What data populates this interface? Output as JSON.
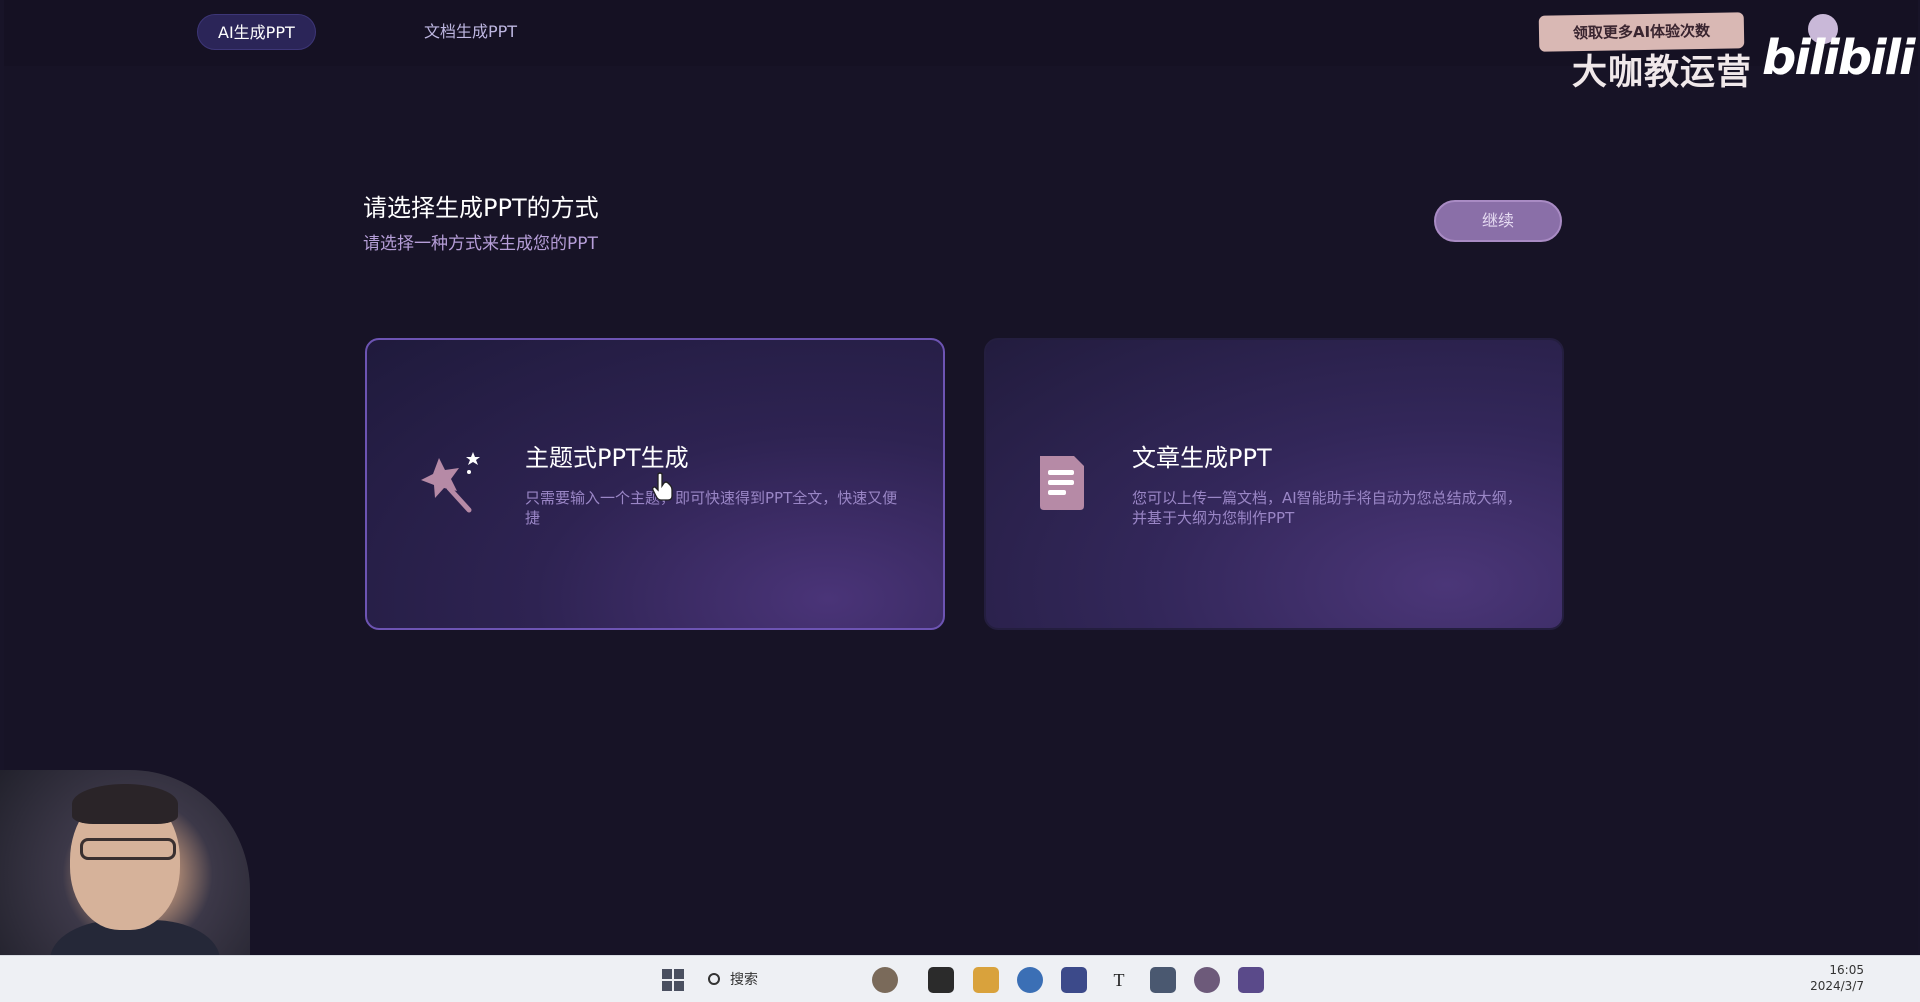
{
  "tabs": {
    "active_label": "AI生成PPT",
    "inactive_label": "文档生成PPT"
  },
  "overlay": {
    "promo": "领取更多AI体验次数",
    "watermark": "大咖教运营",
    "bili": "bilibili"
  },
  "header": {
    "title": "请选择生成PPT的方式",
    "subtitle": "请选择一种方式来生成您的PPT",
    "continue_label": "继续"
  },
  "cards": [
    {
      "title": "主题式PPT生成",
      "description": "只需要输入一个主题，即可快速得到PPT全文，快速又便捷",
      "icon": "magic-wand-icon"
    },
    {
      "title": "文章生成PPT",
      "description": "您可以上传一篇文档，AI智能助手将自动为您总结成大纲，并基于大纲为您制作PPT",
      "icon": "document-icon"
    }
  ],
  "taskbar": {
    "search_label": "搜索",
    "time": "16:05",
    "date": "2024/3/7",
    "icons": [
      "windows-start-icon",
      "search-icon",
      "globe-icon",
      "terminal-icon",
      "folder-icon",
      "edge-icon",
      "store-icon",
      "text-icon",
      "notepad-icon",
      "chat-icon",
      "wps-icon"
    ]
  },
  "colors": {
    "background": "#171326",
    "accent": "#6d54b3",
    "subtitle": "#b69ed8",
    "button": "#8a6fa8"
  }
}
